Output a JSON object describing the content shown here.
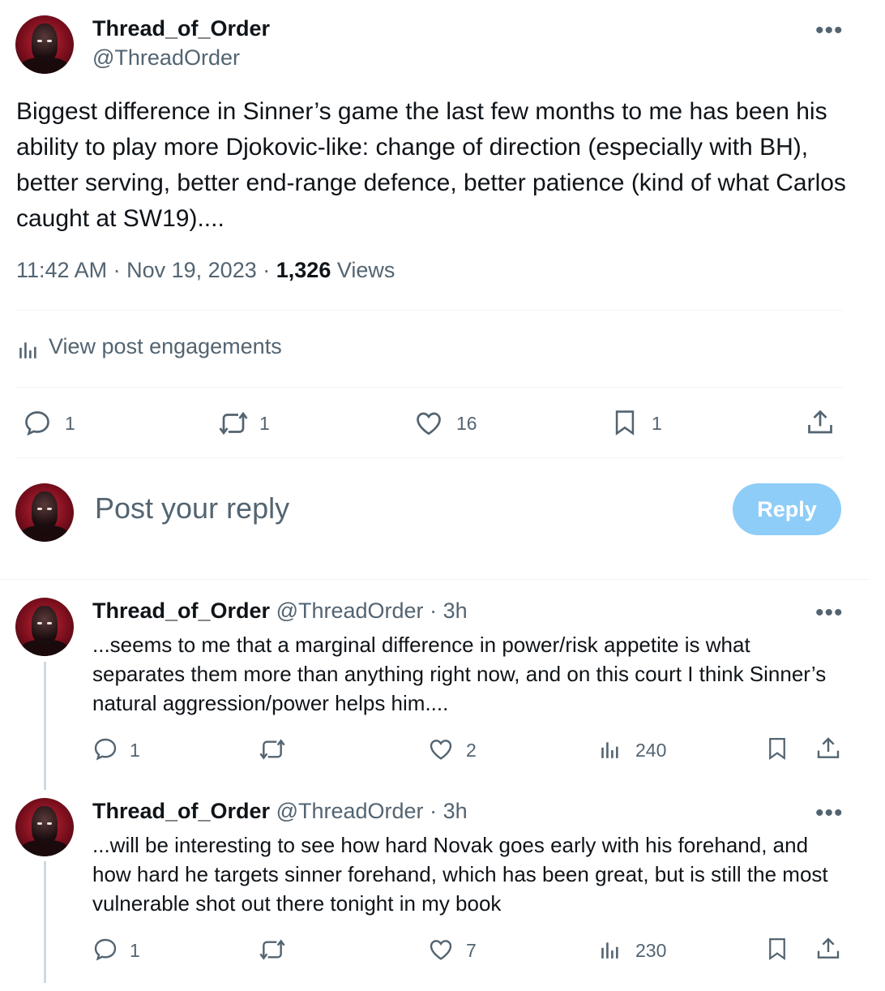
{
  "post": {
    "author_name": "Thread_of_Order",
    "author_handle": "@ThreadOrder",
    "more_label": "•••",
    "text": "Biggest difference in Sinner’s game the last few months to me has been his ability to play more Djokovic-like: change of direction (especially with BH), better serving, better end-range defence, better patience (kind of what Carlos caught at SW19)....",
    "time": "11:42 AM",
    "date": "Nov 19, 2023",
    "dot": "·",
    "views_count": "1,326",
    "views_label": "Views",
    "engagements_label": "View post engagements",
    "actions": {
      "replies": "1",
      "reposts": "1",
      "likes": "16",
      "bookmarks": "1"
    }
  },
  "composer": {
    "placeholder": "Post your reply",
    "button_label": "Reply"
  },
  "replies": [
    {
      "author_name": "Thread_of_Order",
      "author_handle": "@ThreadOrder",
      "time": "· 3h",
      "text": "...seems to me that a marginal difference in power/risk appetite is what separates them more than anything right now, and on this court I think Sinner’s natural aggression/power helps him....",
      "replies": "1",
      "likes": "2",
      "views": "240"
    },
    {
      "author_name": "Thread_of_Order",
      "author_handle": "@ThreadOrder",
      "time": "· 3h",
      "text": "...will be interesting to see how hard Novak goes early with his forehand, and how hard he targets sinner forehand, which has been great, but is still the most vulnerable shot out there tonight in my book",
      "replies": "1",
      "likes": "7",
      "views": "230"
    }
  ],
  "colors": {
    "text": "#0f1419",
    "secondary": "#536471",
    "reply_button": "#8ecdf8",
    "divider": "#eff3f4"
  }
}
